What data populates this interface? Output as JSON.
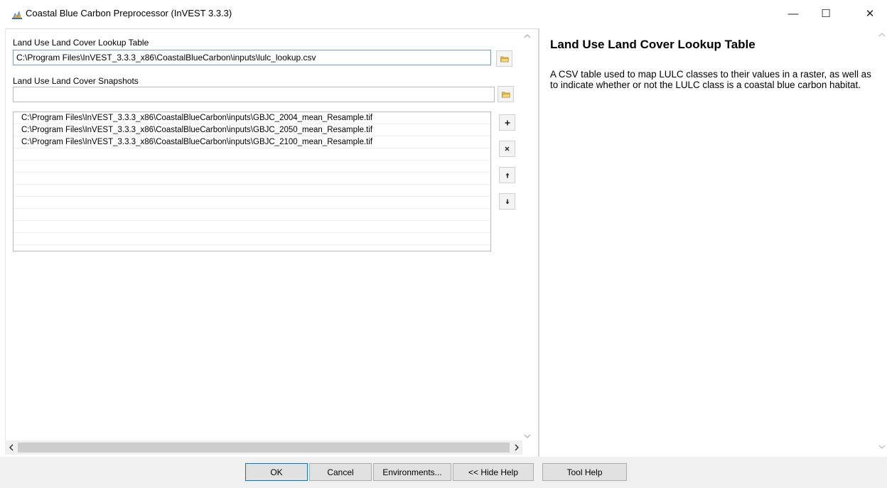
{
  "window": {
    "title": "Coastal Blue Carbon Preprocessor (InVEST 3.3.3)",
    "minimize": "—",
    "maximize": "☐",
    "close": "✕",
    "icon": "invest-tool-icon"
  },
  "form": {
    "lookup_table": {
      "label": "Land Use Land Cover Lookup Table",
      "value": "C:\\Program Files\\InVEST_3.3.3_x86\\CoastalBlueCarbon\\inputs\\lulc_lookup.csv",
      "browse_icon": "folder-open-icon"
    },
    "snapshots": {
      "label": "Land Use Land Cover Snapshots",
      "value": "",
      "browse_icon": "folder-open-icon",
      "items": [
        "C:\\Program Files\\InVEST_3.3.3_x86\\CoastalBlueCarbon\\inputs\\GBJC_2004_mean_Resample.tif",
        "C:\\Program Files\\InVEST_3.3.3_x86\\CoastalBlueCarbon\\inputs\\GBJC_2050_mean_Resample.tif",
        "C:\\Program Files\\InVEST_3.3.3_x86\\CoastalBlueCarbon\\inputs\\GBJC_2100_mean_Resample.tif",
        "",
        "",
        "",
        "",
        "",
        "",
        "",
        "",
        ""
      ],
      "add_icon": "plus-icon",
      "remove_icon": "x-icon",
      "up_icon": "arrow-up-icon",
      "down_icon": "arrow-down-icon"
    }
  },
  "help": {
    "title": "Land Use Land Cover Lookup Table",
    "body": "A CSV table used to map LULC classes to their values in a raster, as well as to indicate whether or not the LULC class is a coastal blue carbon habitat."
  },
  "buttons": {
    "ok": "OK",
    "cancel": "Cancel",
    "environments": "Environments...",
    "hide_help": "<< Hide Help",
    "tool_help": "Tool Help"
  }
}
